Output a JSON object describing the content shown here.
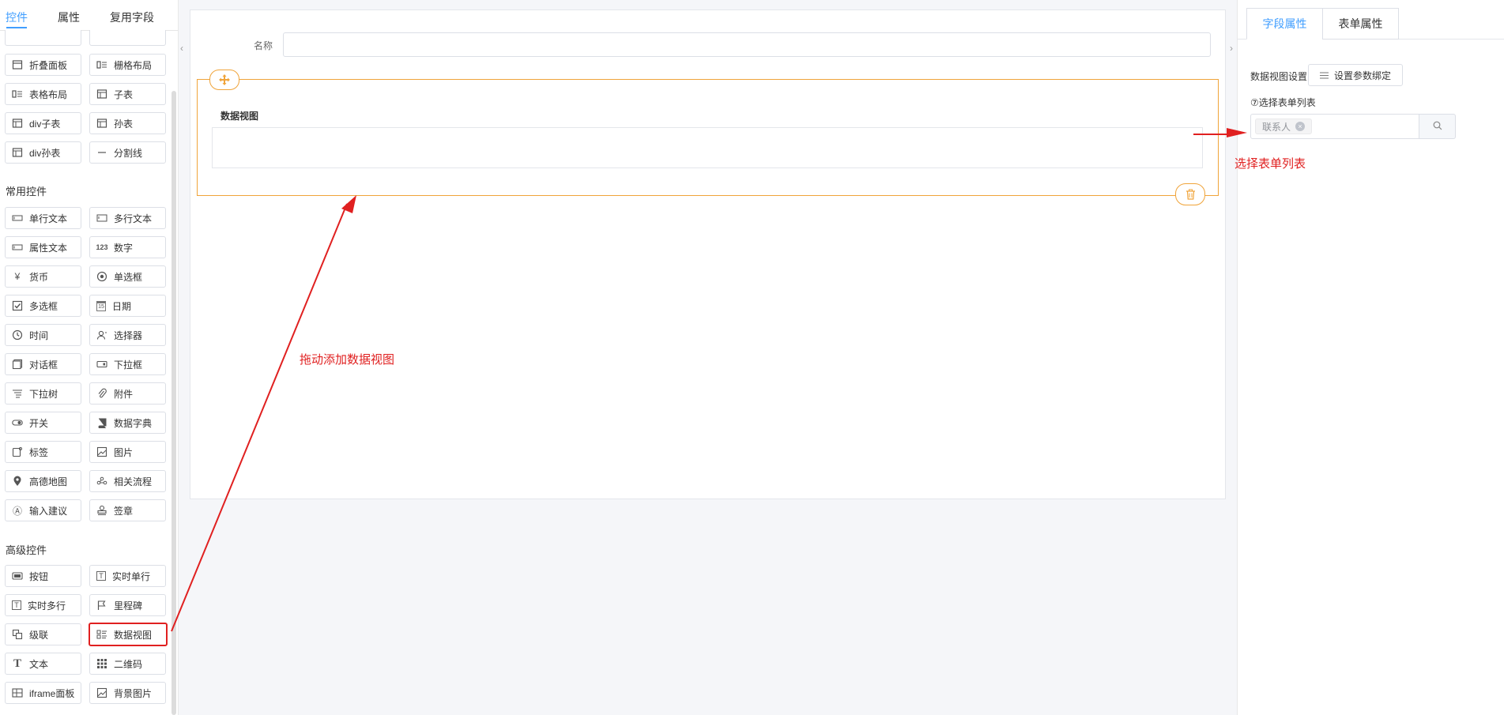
{
  "left_tabs": [
    {
      "label": "控件",
      "active": true
    },
    {
      "label": "属性",
      "active": false
    },
    {
      "label": "复用字段",
      "active": false
    }
  ],
  "layout_components": [
    {
      "label": "折叠面板",
      "icon": "collapse-panel-icon"
    },
    {
      "label": "栅格布局",
      "icon": "grid-layout-icon"
    },
    {
      "label": "表格布局",
      "icon": "table-layout-icon"
    },
    {
      "label": "子表",
      "icon": "subtable-icon"
    },
    {
      "label": "div子表",
      "icon": "div-subtable-icon"
    },
    {
      "label": "孙表",
      "icon": "grandchild-table-icon"
    },
    {
      "label": "div孙表",
      "icon": "div-grandchild-table-icon"
    },
    {
      "label": "分割线",
      "icon": "divider-icon"
    }
  ],
  "common_title": "常用控件",
  "common_components": [
    {
      "label": "单行文本",
      "icon": "single-line-text-icon"
    },
    {
      "label": "多行文本",
      "icon": "multi-line-text-icon"
    },
    {
      "label": "属性文本",
      "icon": "attribute-text-icon"
    },
    {
      "label": "数字",
      "icon": "number-icon",
      "glyph": "123"
    },
    {
      "label": "货币",
      "icon": "currency-icon",
      "glyph": "¥"
    },
    {
      "label": "单选框",
      "icon": "radio-icon"
    },
    {
      "label": "多选框",
      "icon": "checkbox-icon"
    },
    {
      "label": "日期",
      "icon": "date-icon",
      "glyph": "15"
    },
    {
      "label": "时间",
      "icon": "clock-icon"
    },
    {
      "label": "选择器",
      "icon": "user-selector-icon"
    },
    {
      "label": "对话框",
      "icon": "dialog-icon"
    },
    {
      "label": "下拉框",
      "icon": "dropdown-icon"
    },
    {
      "label": "下拉树",
      "icon": "dropdown-tree-icon"
    },
    {
      "label": "附件",
      "icon": "paperclip-icon"
    },
    {
      "label": "开关",
      "icon": "toggle-icon"
    },
    {
      "label": "数据字典",
      "icon": "book-icon"
    },
    {
      "label": "标签",
      "icon": "tag-icon"
    },
    {
      "label": "图片",
      "icon": "image-icon"
    },
    {
      "label": "高德地图",
      "icon": "map-pin-icon"
    },
    {
      "label": "相关流程",
      "icon": "flow-icon"
    },
    {
      "label": "输入建议",
      "icon": "suggestion-icon",
      "glyph": "Ⓐ"
    },
    {
      "label": "签章",
      "icon": "stamp-icon"
    }
  ],
  "advanced_title": "高级控件",
  "advanced_components": [
    {
      "label": "按钮",
      "icon": "button-icon"
    },
    {
      "label": "实时单行",
      "icon": "realtime-single-icon",
      "glyph": "T"
    },
    {
      "label": "实时多行",
      "icon": "realtime-multi-icon",
      "glyph": "T"
    },
    {
      "label": "里程碑",
      "icon": "flag-icon"
    },
    {
      "label": "级联",
      "icon": "cascade-icon"
    },
    {
      "label": "数据视图",
      "icon": "data-view-icon",
      "highlight": true
    },
    {
      "label": "文本",
      "icon": "text-icon",
      "glyph": "T"
    },
    {
      "label": "二维码",
      "icon": "qrcode-icon"
    },
    {
      "label": "iframe面板",
      "icon": "iframe-icon"
    },
    {
      "label": "背景图片",
      "icon": "background-image-icon"
    }
  ],
  "canvas": {
    "name_label": "名称",
    "widget_title": "数据视图"
  },
  "right_tabs": [
    {
      "label": "字段属性",
      "active": true
    },
    {
      "label": "表单属性",
      "active": false
    }
  ],
  "right_panel": {
    "setting_label": "数据视图设置",
    "bind_button": "设置参数绑定",
    "list_label": "⑦选择表单列表",
    "selected_tag": "联系人"
  },
  "annotations": {
    "drag_text": "拖动添加数据视图",
    "select_text": "选择表单列表"
  },
  "colors": {
    "accent": "#409eff",
    "widget_border": "#f0a43a",
    "annotation": "#e02020"
  }
}
